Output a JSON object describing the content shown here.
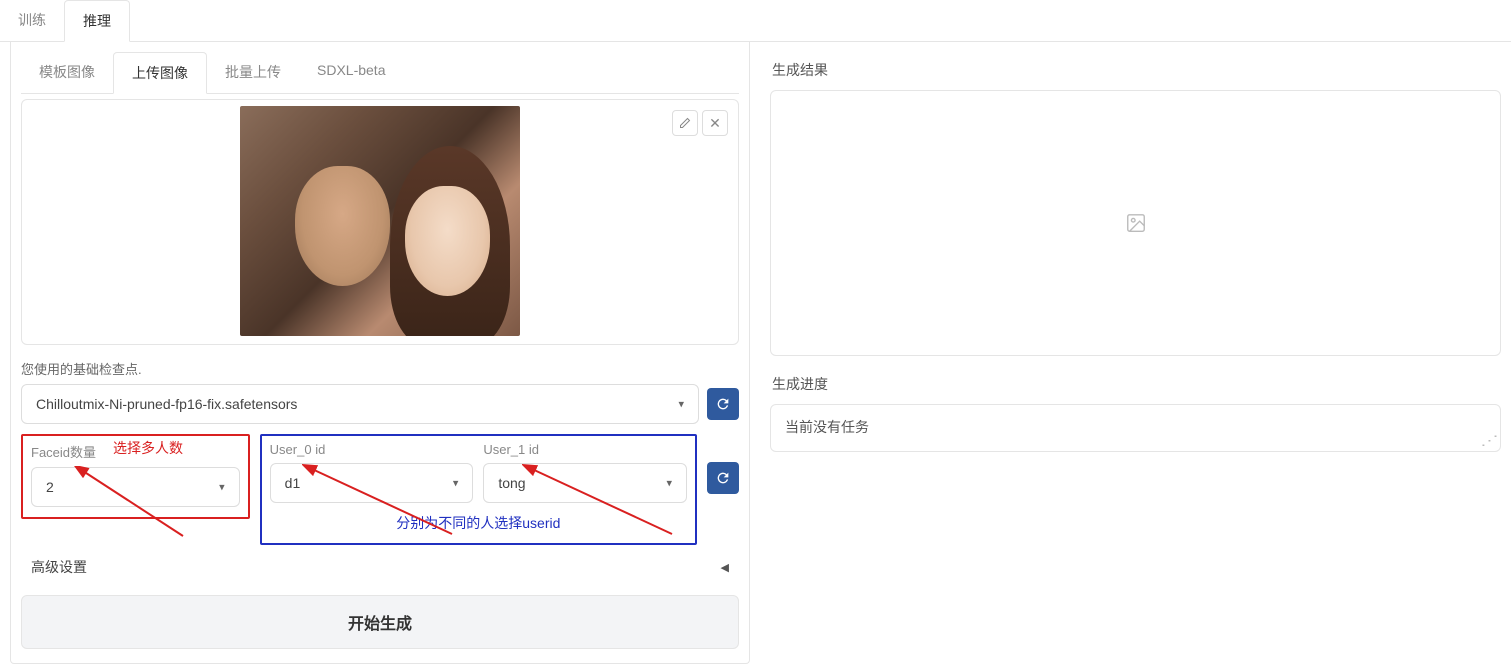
{
  "topTabs": {
    "train": "训练",
    "infer": "推理"
  },
  "subTabs": {
    "template": "模板图像",
    "upload": "上传图像",
    "batch": "批量上传",
    "sdxl": "SDXL-beta"
  },
  "checkpoint": {
    "label": "您使用的基础检查点.",
    "value": "Chilloutmix-Ni-pruned-fp16-fix.safetensors"
  },
  "faceid": {
    "label": "Faceid数量",
    "value": "2",
    "annotation": "选择多人数"
  },
  "user0": {
    "label": "User_0 id",
    "value": "d1"
  },
  "user1": {
    "label": "User_1 id",
    "value": "tong"
  },
  "userAnnotation": "分别为不同的人选择userid",
  "advanced": "高级设置",
  "generate": "开始生成",
  "result": {
    "label": "生成结果"
  },
  "progress": {
    "label": "生成进度",
    "value": "当前没有任务"
  }
}
